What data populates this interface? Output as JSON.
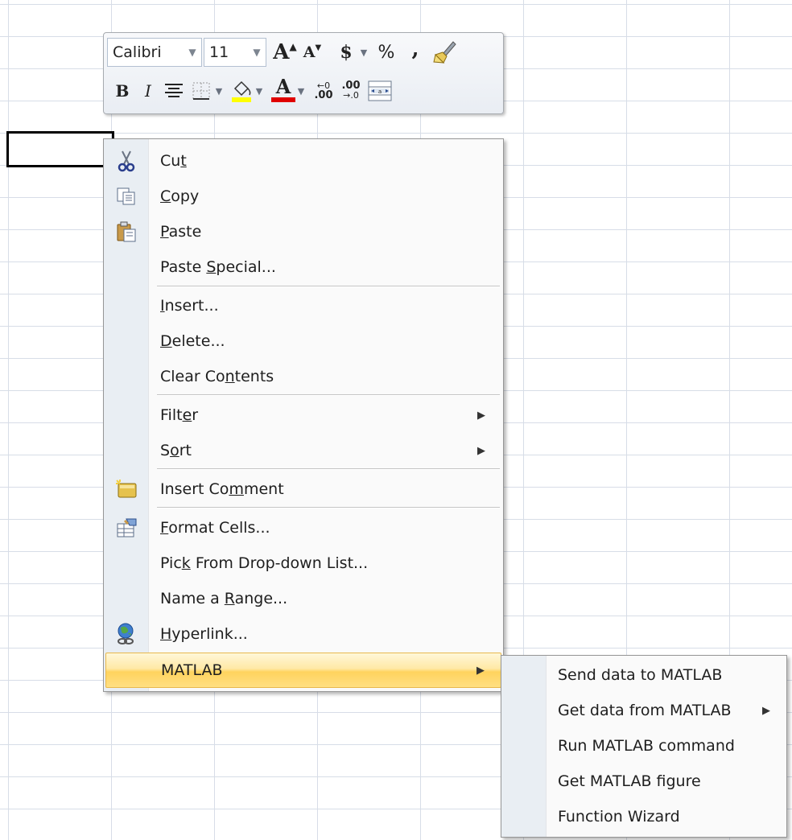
{
  "toolbar": {
    "font_name": "Calibri",
    "font_size": "11",
    "grow_font_glyph": "A",
    "shrink_font_glyph": "A",
    "currency_glyph": "$",
    "percent_glyph": "%",
    "comma_glyph": ",",
    "bold_glyph": "B",
    "italic_glyph": "I",
    "font_color_glyph": "A",
    "increase_decimal_glyph": ".00",
    "decrease_decimal_glyph": ".00",
    "highlight_color": "#ffff00",
    "font_color": "#e00000"
  },
  "context_menu": {
    "items": [
      {
        "pre": "Cu",
        "ul": "t",
        "post": ""
      },
      {
        "pre": "",
        "ul": "C",
        "post": "opy"
      },
      {
        "pre": "",
        "ul": "P",
        "post": "aste"
      },
      {
        "pre": "Paste ",
        "ul": "S",
        "post": "pecial..."
      },
      {
        "pre": "",
        "ul": "I",
        "post": "nsert..."
      },
      {
        "pre": "",
        "ul": "D",
        "post": "elete..."
      },
      {
        "pre": "Clear Co",
        "ul": "n",
        "post": "tents"
      },
      {
        "pre": "Filt",
        "ul": "e",
        "post": "r"
      },
      {
        "pre": "S",
        "ul": "o",
        "post": "rt"
      },
      {
        "pre": "Insert Co",
        "ul": "m",
        "post": "ment"
      },
      {
        "pre": "",
        "ul": "F",
        "post": "ormat Cells..."
      },
      {
        "pre": "Pic",
        "ul": "k",
        "post": " From Drop-down List..."
      },
      {
        "pre": "Name a ",
        "ul": "R",
        "post": "ange..."
      },
      {
        "pre": "",
        "ul": "H",
        "post": "yperlink..."
      },
      {
        "pre": "MATLAB",
        "ul": "",
        "post": ""
      }
    ],
    "submenu_arrow": "▶"
  },
  "matlab_submenu": {
    "items": [
      "Send data to MATLAB",
      "Get data from MATLAB",
      "Run MATLAB command",
      "Get MATLAB figure",
      "Function Wizard"
    ]
  }
}
